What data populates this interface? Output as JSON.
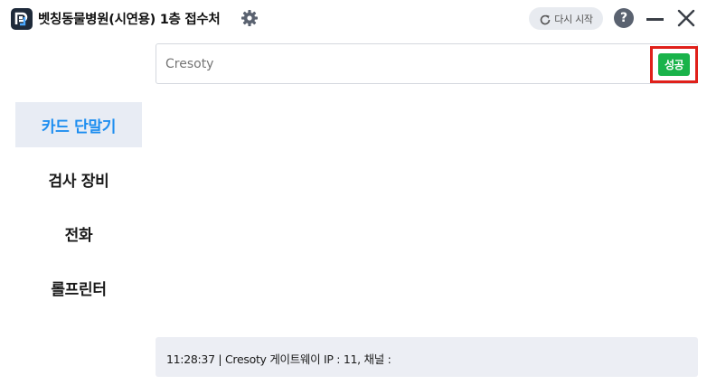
{
  "window": {
    "title": "벳칭동물병원(시연용) 1층 접수처",
    "restart_label": "다시 시작",
    "help_label": "?"
  },
  "search": {
    "value": "",
    "placeholder": "Cresoty",
    "status_label": "성공",
    "status_color": "#19b34a",
    "highlight_color": "#e0201a"
  },
  "sidebar": {
    "items": [
      {
        "label": "카드 단말기",
        "active": true
      },
      {
        "label": "검사 장비",
        "active": false
      },
      {
        "label": "전화",
        "active": false
      },
      {
        "label": "롤프린터",
        "active": false
      }
    ]
  },
  "footer": {
    "status_text": "11:28:37 | Cresoty 게이트웨이 IP : 11, 채널 :"
  },
  "colors": {
    "accent": "#1e8ef0",
    "active_bg": "#e8ecf4",
    "footer_bg": "#eceef4"
  },
  "icons": [
    "app-logo-icon",
    "gear-icon",
    "refresh-icon",
    "help-icon",
    "minimize-icon",
    "close-icon"
  ]
}
